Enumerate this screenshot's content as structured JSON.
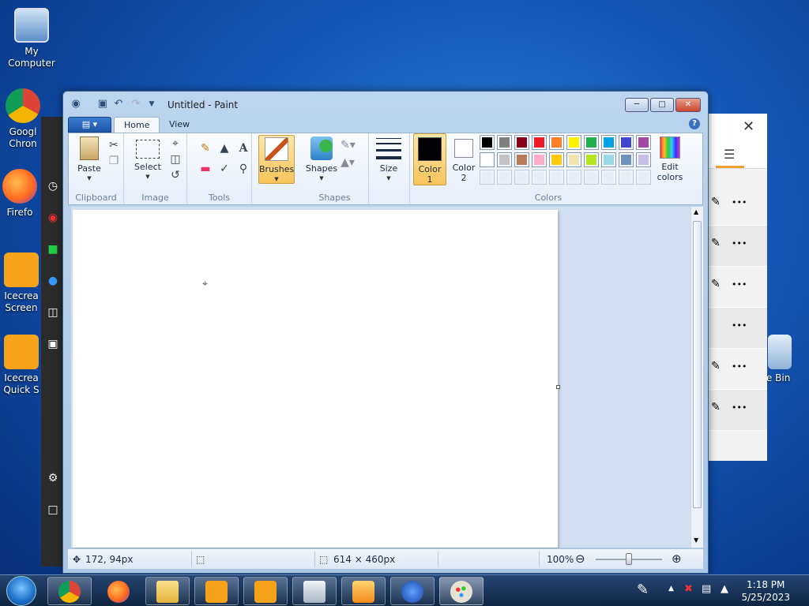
{
  "desktop": {
    "icons": [
      {
        "label": "My Computer"
      },
      {
        "label": "Googl\nChron"
      },
      {
        "label": "Firefo"
      },
      {
        "label": "Icecrea\nScreen"
      },
      {
        "label": "Icecrea\nQuick S"
      },
      {
        "label": "cle Bin"
      }
    ]
  },
  "background_app": {
    "row_menu": "•••"
  },
  "paint": {
    "title": "Untitled - Paint",
    "tabs": {
      "home": "Home",
      "view": "View"
    },
    "help": "?",
    "clipboard": {
      "paste": "Paste",
      "group": "Clipboard"
    },
    "image": {
      "select": "Select",
      "group": "Image"
    },
    "tools": {
      "group": "Tools",
      "text_tool": "A"
    },
    "brushes": {
      "label": "Brushes"
    },
    "shapes": {
      "label": "Shapes",
      "group": "Shapes"
    },
    "size": {
      "label": "Size"
    },
    "color1": {
      "label": "Color\n1",
      "color": "#000000"
    },
    "color2": {
      "label": "Color\n2",
      "color": "#ffffff"
    },
    "edit_colors": {
      "label": "Edit\ncolors"
    },
    "colors_group": "Colors",
    "palette_row1": [
      "#000000",
      "#7f7f7f",
      "#880015",
      "#ed1c24",
      "#ff7f27",
      "#fff200",
      "#22b14c",
      "#00a2e8",
      "#3f48cc",
      "#a349a4"
    ],
    "palette_row2": [
      "#ffffff",
      "#c3c3c3",
      "#b97a57",
      "#ffaec9",
      "#ffc90e",
      "#efe4b0",
      "#b5e61d",
      "#99d9ea",
      "#7092be",
      "#c8bfe7"
    ],
    "status": {
      "cursor_pos": "172, 94px",
      "image_size": "614 × 460px",
      "zoom": "100%"
    }
  },
  "taskbar": {
    "time": "1:18 PM",
    "date": "5/25/2023"
  }
}
